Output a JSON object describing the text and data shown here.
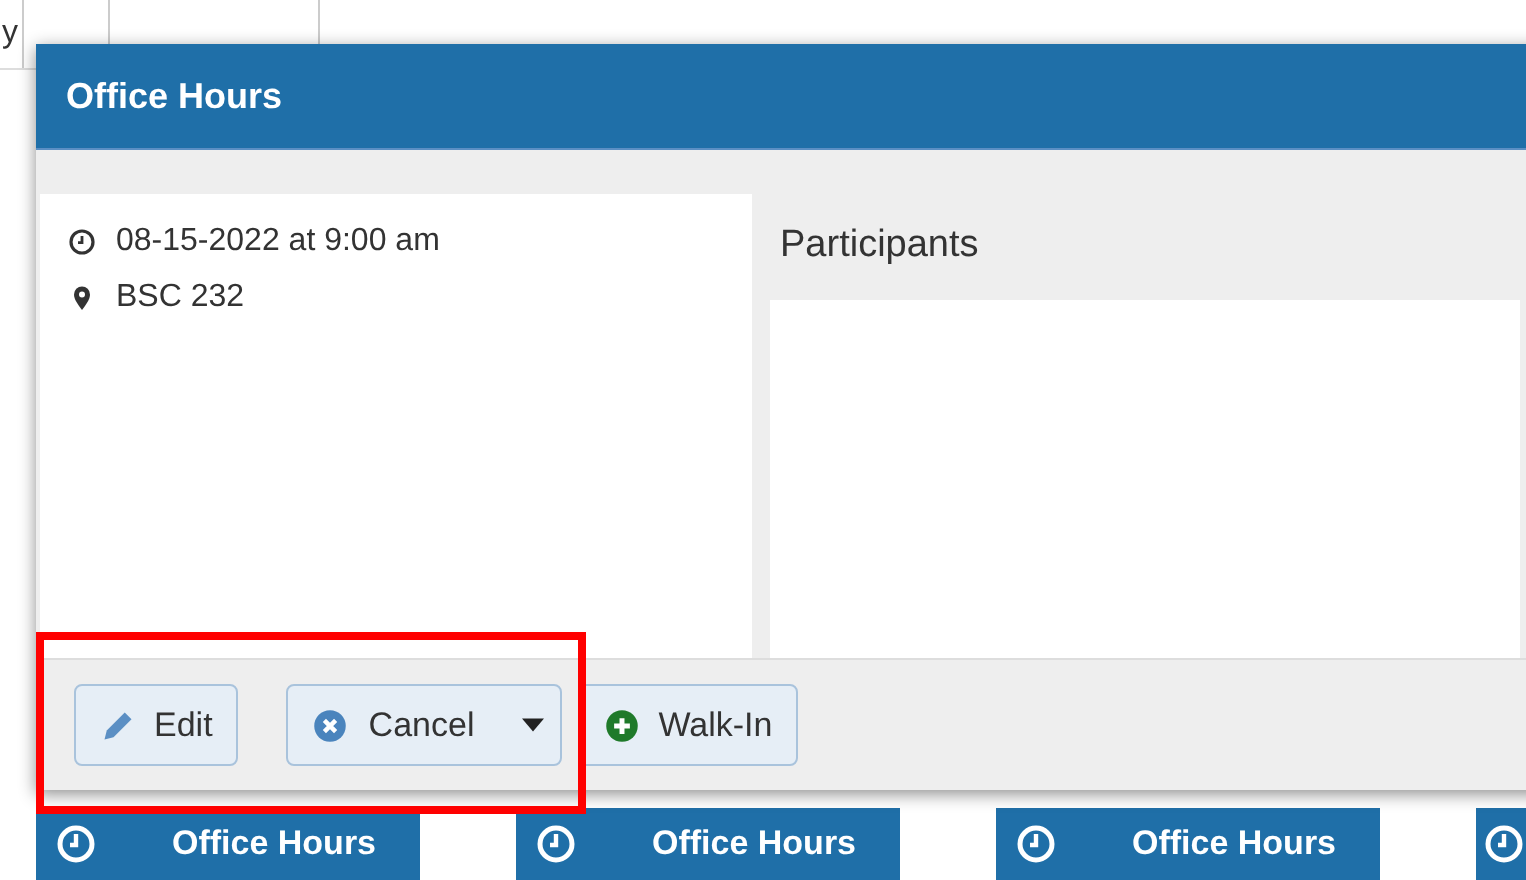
{
  "calendar": {
    "view_tabs": [
      {
        "label": "y"
      }
    ],
    "events": [
      {
        "title": "Office Hours"
      },
      {
        "title": "Office Hours"
      },
      {
        "title": "Office Hours"
      }
    ]
  },
  "dialog": {
    "title": "Office Hours",
    "datetime": "08-15-2022 at 9:00 am",
    "location": "BSC 232",
    "participants_label": "Participants",
    "buttons": [
      {
        "label": "Edit",
        "kind": "edit"
      },
      {
        "label": "Cancel",
        "kind": "cancel-dropdown"
      },
      {
        "label": "Walk-In",
        "kind": "add"
      }
    ]
  },
  "annotation": {
    "kind": "highlight-box"
  }
}
